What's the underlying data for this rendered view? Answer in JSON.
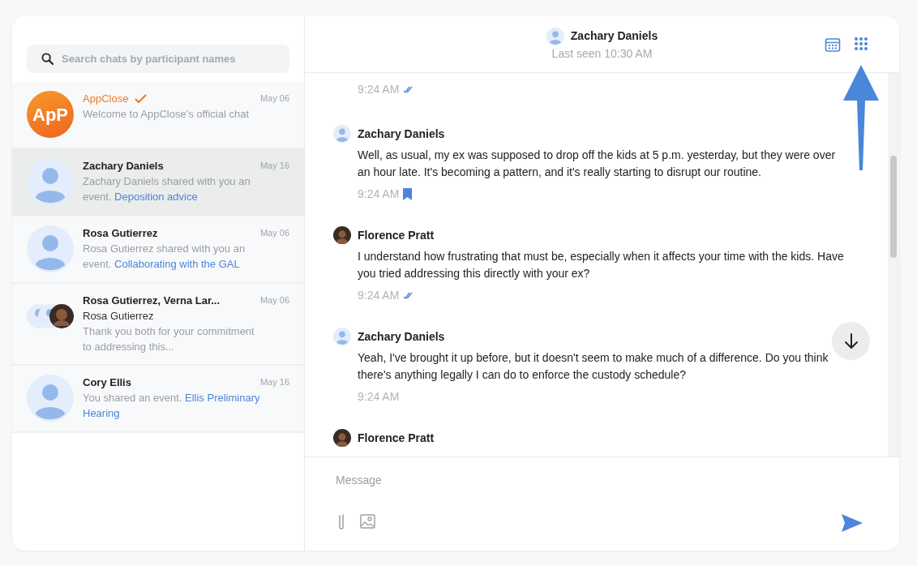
{
  "search": {
    "placeholder": "Search chats by participant names"
  },
  "conversations": [
    {
      "name": "AppClose",
      "verified": true,
      "kind": "app",
      "avatar_text": "ApP",
      "date": "May 06",
      "selected": false,
      "preview": "Welcome to AppClose's official chat"
    },
    {
      "name": "Zachary Daniels",
      "kind": "person",
      "date": "May 16",
      "selected": true,
      "preview": "Zachary Daniels shared with you an event.",
      "link": "Deposition advice"
    },
    {
      "name": "Rosa Gutierrez",
      "kind": "person",
      "date": "May 06",
      "selected": false,
      "preview": "Rosa Gutierrez shared with you an event.",
      "link": "Collaborating with the GAL"
    },
    {
      "name": "Rosa Gutierrez, Verna Lar...",
      "kind": "group",
      "date": "May 06",
      "selected": false,
      "sender": "Rosa Gutierrez",
      "preview": "Thank you both for your commitment to addressing this..."
    },
    {
      "name": "Cory Ellis",
      "kind": "person",
      "date": "May 16",
      "selected": false,
      "preview": "You shared an event.",
      "link": "Ellis Preliminary Hearing"
    }
  ],
  "chat_header": {
    "name": "Zachary Daniels",
    "status": "Last seen 10:30 AM"
  },
  "messages": [
    {
      "kind": "time",
      "time": "9:24 AM",
      "read": true,
      "bookmarked": false
    },
    {
      "kind": "message",
      "sender": "Zachary Daniels",
      "photo": false,
      "text": "Well, as usual, my ex was supposed to drop off the kids at 5 p.m. yesterday, but they were over an hour late. It's becoming a pattern, and it's really starting to disrupt our routine.",
      "time": "9:24 AM",
      "read": false,
      "bookmarked": true
    },
    {
      "kind": "message",
      "sender": "Florence Pratt",
      "photo": true,
      "text": "I understand how frustrating that must be, especially when it affects your time with the kids. Have you tried addressing this directly with your ex?",
      "time": "9:24 AM",
      "read": true,
      "bookmarked": false
    },
    {
      "kind": "message",
      "sender": "Zachary Daniels",
      "photo": false,
      "text": "Yeah, I've brought it up before, but it doesn't seem to make much of a difference. Do you think there's anything legally I can do to enforce the custody schedule?",
      "time": "9:24 AM",
      "read": false,
      "bookmarked": false
    },
    {
      "kind": "name",
      "sender": "Florence Pratt",
      "photo": true
    }
  ],
  "composer": {
    "placeholder": "Message"
  }
}
